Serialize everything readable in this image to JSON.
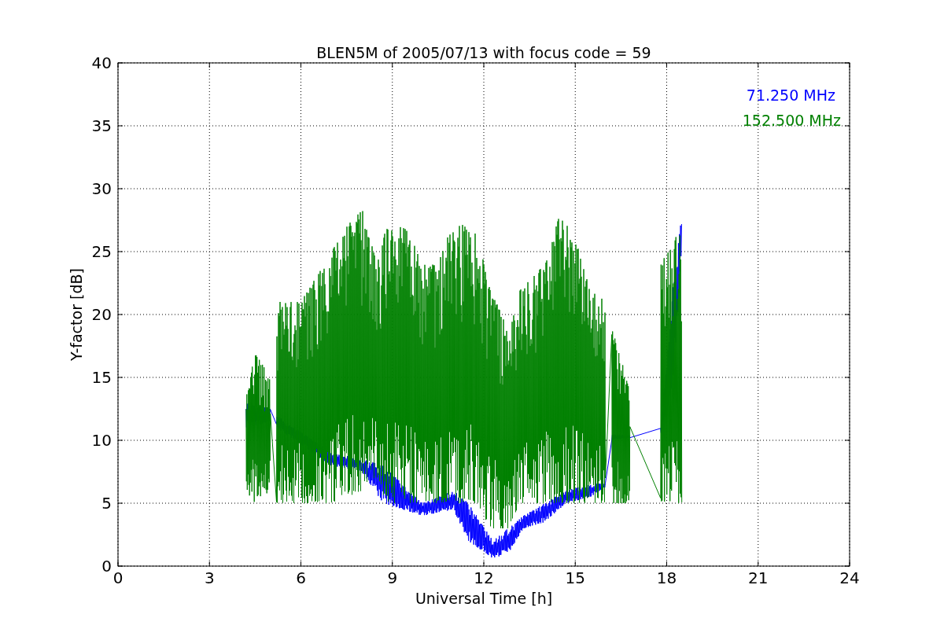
{
  "plot": {
    "title": "BLEN5M of 2005/07/13 with focus code = 59",
    "xlabel": "Universal Time [h]",
    "ylabel": "Y-factor [dB]",
    "xticks": [
      "0",
      "3",
      "6",
      "9",
      "12",
      "15",
      "18",
      "21",
      "24"
    ],
    "yticks": [
      "40",
      "35",
      "30",
      "25",
      "20",
      "15",
      "10",
      "5",
      "0"
    ],
    "legend": [
      {
        "label": "71.250 MHz",
        "color": "#0000ff"
      },
      {
        "label": "152.500 MHz",
        "color": "#008000"
      }
    ]
  }
}
